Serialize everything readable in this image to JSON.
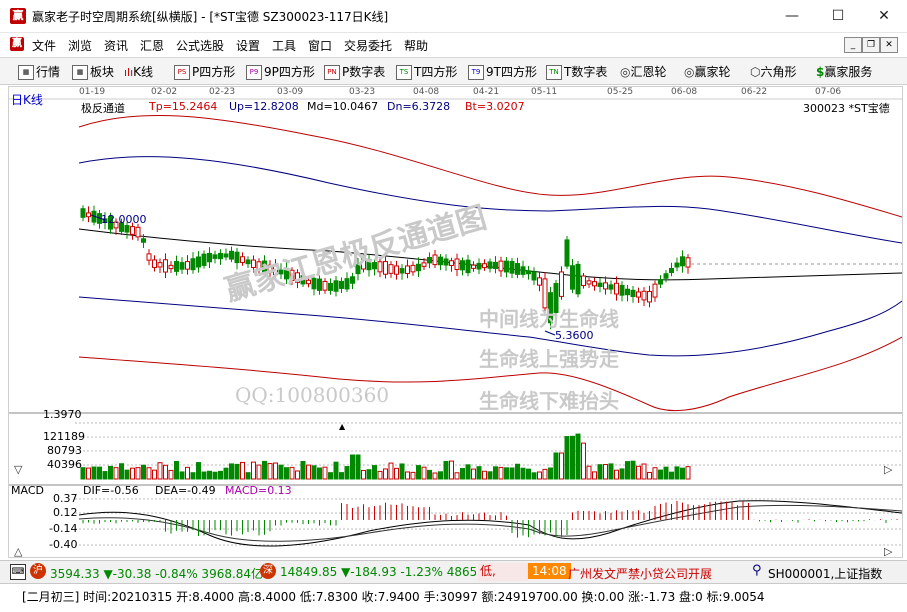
{
  "window": {
    "logo": "赢",
    "title": "赢家老子时空周期系统[纵横版] - [*ST宝德  SZ300023-117日K线]",
    "minimize": "—",
    "maximize": "☐",
    "close": "✕"
  },
  "menu": [
    "文件",
    "浏览",
    "资讯",
    "汇恩",
    "公式选股",
    "设置",
    "工具",
    "窗口",
    "交易委托",
    "帮助"
  ],
  "mdi": [
    "_",
    "❐",
    "✕"
  ],
  "toolbar": [
    {
      "icon": "grid",
      "label": "行情"
    },
    {
      "icon": "grid",
      "label": "板块"
    },
    {
      "icon": "kline",
      "label": "K线"
    },
    {
      "icon": "PS",
      "label": "P四方形"
    },
    {
      "icon": "P9",
      "label": "9P四方形"
    },
    {
      "icon": "PN",
      "label": "P数字表"
    },
    {
      "icon": "TS",
      "label": "T四方形"
    },
    {
      "icon": "T9",
      "label": "9T四方形"
    },
    {
      "icon": "TN",
      "label": "T数字表"
    },
    {
      "icon": "circle",
      "label": "汇恩轮"
    },
    {
      "icon": "circle",
      "label": "赢家轮"
    },
    {
      "icon": "hex",
      "label": "六角形"
    },
    {
      "icon": "dollar",
      "label": "赢家服务"
    }
  ],
  "chart": {
    "period_label": "日K线",
    "dates": [
      "01-19",
      "02-02",
      "02-23",
      "03-09",
      "03-23",
      "04-08",
      "04-21",
      "05-11",
      "05-25",
      "06-08",
      "06-22",
      "07-06"
    ],
    "indicator": "极反通道",
    "tp": "Tp=15.2464",
    "up": "Up=12.8208",
    "md": "Md=10.0467",
    "dn": "Dn=6.3728",
    "bt": "Bt=3.0207",
    "stock": "300023  *ST宝德",
    "high_mark": "12.0000",
    "low_mark": "5.3600",
    "vol_top": "1.3970",
    "vol_ticks": [
      "121189",
      "80793",
      "40396"
    ],
    "watermark_1": "赢家江恩极反通道图",
    "watermark_2": "中间线为生命线",
    "watermark_3": "生命线上强势走",
    "watermark_4": "生命线下难抬头",
    "watermark_qq": "QQ:100800360"
  },
  "macd": {
    "label": "MACD",
    "dif": "DIF=-0.56",
    "dea": "DEA=-0.49",
    "macd": "MACD=0.13",
    "ticks": [
      "0.37",
      "0.12",
      "-0.14",
      "-0.40"
    ]
  },
  "status1": {
    "sh_icon": "沪",
    "sh_values": "3594.33 ▼-30.38 -0.84% 3968.84亿",
    "sz_icon": "深",
    "sz_values": "14849.85 ▼-184.93 -1.23% 4865.",
    "ticker_left": "低,",
    "time": "14:08",
    "news": "广州发文严禁小贷公司开展",
    "index": "SH000001,上证指数"
  },
  "status2": "[二月初三] 时间:20210315 开:8.4000 高:8.4000 低:7.8300 收:7.9400 手:30997 额:24919700.00 换:0.00 涨:-1.73 盘:0 标:9.0054",
  "colors": {
    "red": "#cc0000",
    "green": "#008800",
    "navy": "#000080",
    "gridline": "#9a9a9a"
  }
}
